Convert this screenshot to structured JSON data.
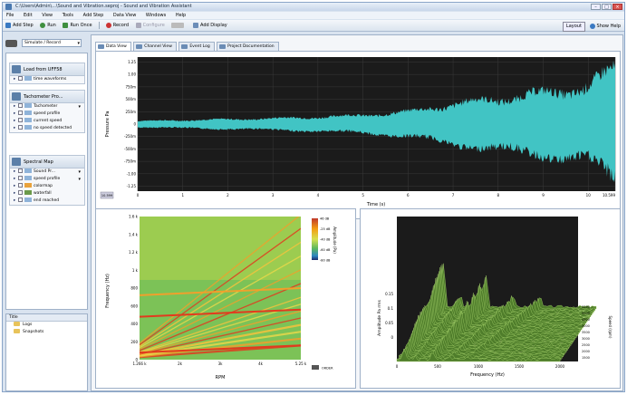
{
  "window": {
    "title": "C:\\Users\\Admin\\...\\Sound and Vibration.seproj - Sound and Vibration Assistant"
  },
  "menu": [
    "File",
    "Edit",
    "View",
    "Tools",
    "Add Step",
    "Data View",
    "Windows",
    "Help"
  ],
  "toolbar": {
    "add_step": "Add Step",
    "run": "Run",
    "run_once": "Run Once",
    "record": "Record",
    "configure": "Configure",
    "add_display": "Add Display",
    "layout": "Layout",
    "show_help": "Show Help"
  },
  "device_combo": "Simulate / Record",
  "steps": [
    {
      "title": "Load from UFF58",
      "rows": [
        {
          "label": "time waveforms"
        }
      ]
    },
    {
      "title": "Tachometer Pro...",
      "rows": [
        {
          "label": "Tachometer"
        },
        {
          "label": "speed profile"
        },
        {
          "label": "current speed"
        },
        {
          "label": "no speed detected"
        }
      ]
    },
    {
      "title": "Spectral Map",
      "rows": [
        {
          "label": "Sound Pr..."
        },
        {
          "label": "speed profile"
        },
        {
          "label": "colormap"
        },
        {
          "label": "waterfall"
        },
        {
          "label": "end reached"
        }
      ]
    }
  ],
  "files_pane": {
    "header": "Title",
    "items": [
      "Logs",
      "Snapshots"
    ]
  },
  "tabs": [
    "Data View",
    "Channel View",
    "Event Log",
    "Project Documentation"
  ],
  "chart_data": [
    {
      "type": "line",
      "title": "",
      "xlabel": "Time (s)",
      "ylabel": "Pressure Pa",
      "x_ticks": [
        "0",
        "1",
        "2",
        "3",
        "4",
        "5",
        "6",
        "7",
        "8",
        "9",
        "10",
        "10.599"
      ],
      "y_ticks": [
        "1.25",
        "1.00",
        "750m",
        "500m",
        "250m",
        "0",
        "-250m",
        "-500m",
        "-750m",
        "-1.00",
        "-1.25"
      ],
      "xlim": [
        0,
        10.599
      ],
      "ylim": [
        -1.35,
        1.35
      ],
      "envelope": {
        "t": [
          0,
          1,
          2,
          3,
          4,
          5,
          6,
          7,
          8,
          9,
          10,
          10.599
        ],
        "amplitude": [
          0.07,
          0.09,
          0.11,
          0.13,
          0.16,
          0.2,
          0.28,
          0.45,
          0.58,
          0.7,
          0.85,
          1.25
        ]
      },
      "series": [
        {
          "color": "#41c4c4"
        }
      ],
      "x_selector": "10.599",
      "background": "#1b1b1b",
      "grid": true
    },
    {
      "type": "heatmap",
      "title": "",
      "xlabel": "RPM",
      "ylabel": "Frequency (Hz)",
      "x_ticks": [
        "1.266 k",
        "2k",
        "3k",
        "4k",
        "5.25 k"
      ],
      "y_ticks": [
        "1.6 k",
        "1.4 k",
        "1.2 k",
        "1 k",
        "800",
        "600",
        "400",
        "200",
        "0"
      ],
      "colorbar": {
        "label": "Amplitude (Pa)",
        "ticks": [
          "46 dB",
          "-25 dB",
          "-40 dB",
          "-60 dB",
          "-80 dB"
        ]
      },
      "legend": "ORDER",
      "orders": [
        1,
        2,
        3,
        4,
        5,
        6,
        7,
        8,
        10,
        12,
        14,
        16,
        18,
        20
      ]
    },
    {
      "type": "waterfall",
      "title": "",
      "xlabel": "Frequency (Hz)",
      "ylabel": "Amplitude Pa rms",
      "zlabel": "Speed (rpm)",
      "x_ticks": [
        "0",
        "500",
        "1000",
        "1500",
        "2000"
      ],
      "y_ticks": [
        "0.15",
        "0.1",
        "0.05",
        "0"
      ],
      "z_ticks": [
        "1500",
        "2000",
        "2500",
        "3000",
        "3500",
        "4000",
        "4500",
        "5000",
        "5250"
      ],
      "peaks_hz": [
        120,
        310,
        600,
        900,
        1200
      ]
    }
  ]
}
